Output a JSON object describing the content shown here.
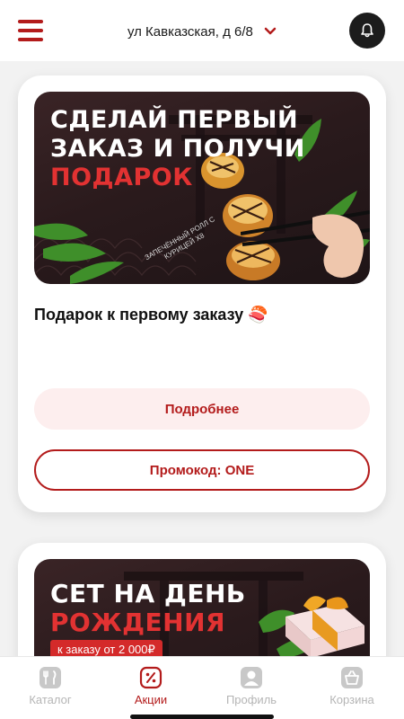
{
  "header": {
    "address": "ул Кавказская, д 6/8"
  },
  "promos": [
    {
      "banner_line1": "СДЕЛАЙ ПЕРВЫЙ",
      "banner_line2": "ЗАКАЗ И ПОЛУЧИ",
      "banner_line3": "ПОДАРОК",
      "roll_label": "ЗАПЕЧЁННЫЙ РОЛЛ С КУРИЦЕЙ Х8",
      "title": "Подарок к первому заказу 🍣",
      "more_label": "Подробнее",
      "promo_label": "Промокод: ONE"
    },
    {
      "banner_line1": "СЕТ НА ДЕНЬ",
      "banner_line2": "РОЖДЕНИЯ",
      "banner_pill": "к заказу от 2 000₽"
    }
  ],
  "nav": {
    "items": [
      {
        "label": "Каталог",
        "icon": "catalog-icon",
        "active": false
      },
      {
        "label": "Акции",
        "icon": "promo-icon",
        "active": true
      },
      {
        "label": "Профиль",
        "icon": "profile-icon",
        "active": false
      },
      {
        "label": "Корзина",
        "icon": "cart-icon",
        "active": false
      }
    ]
  },
  "colors": {
    "accent": "#b31b1b",
    "banner_red": "#e23232",
    "inactive": "#b5b5b5"
  }
}
